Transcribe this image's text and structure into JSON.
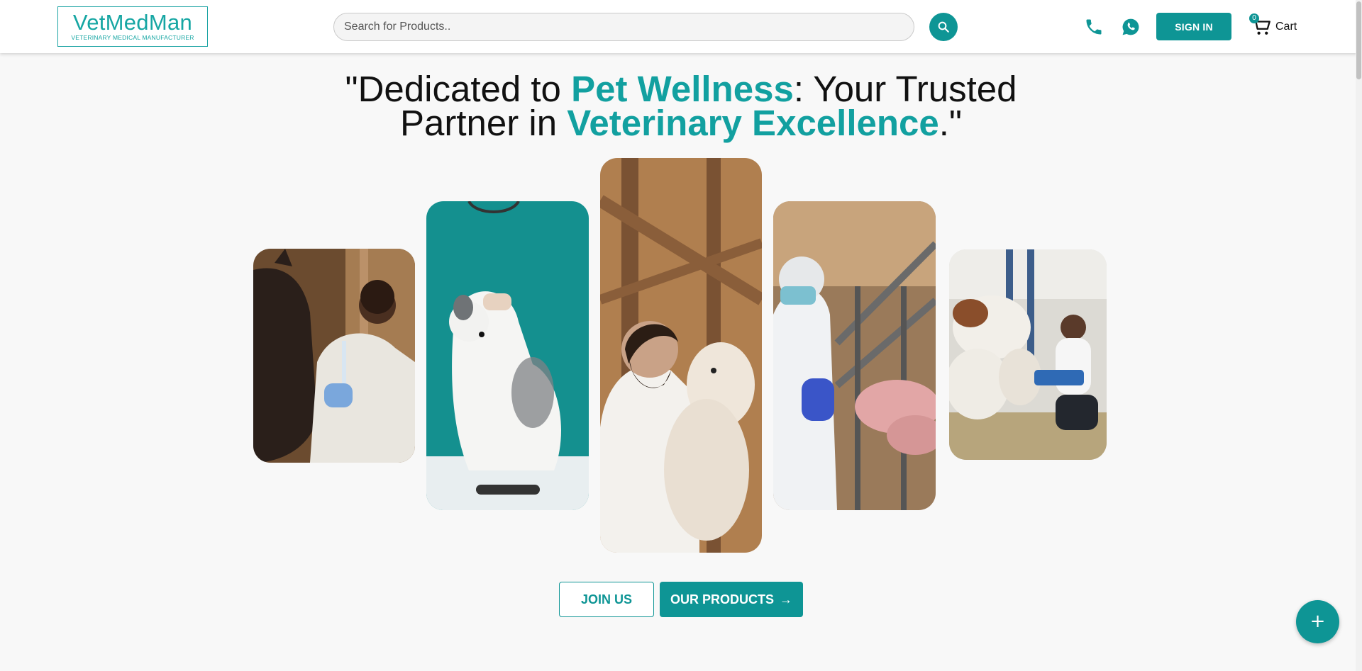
{
  "brand": {
    "name": "VetMedMan",
    "tagline": "VETERINARY MEDICAL MANUFACTURER"
  },
  "header": {
    "search_placeholder": "Search for Products..",
    "search_icon": "search-icon",
    "phone_icon": "phone-icon",
    "whatsapp_icon": "whatsapp-icon",
    "signin_label": "SIGN IN",
    "cart_count": "0",
    "cart_label": "Cart"
  },
  "hero": {
    "part1": "\"Dedicated to ",
    "highlight1": "Pet Wellness",
    "part2": ": Your Trusted Partner in ",
    "highlight2": "Veterinary Excellence",
    "part3": ".\""
  },
  "gallery": {
    "images": [
      "vet-with-horse-image",
      "vet-with-dog-image",
      "vet-with-lamb-image",
      "vet-with-pigs-image",
      "vet-with-cows-image"
    ]
  },
  "cta": {
    "join_label": "JOIN US",
    "products_label": "OUR PRODUCTS",
    "products_arrow": "→"
  },
  "fab": {
    "label": "+"
  },
  "colors": {
    "accent": "#0e9595",
    "highlight_text": "#12a0a0",
    "background": "#f8f8f8"
  }
}
